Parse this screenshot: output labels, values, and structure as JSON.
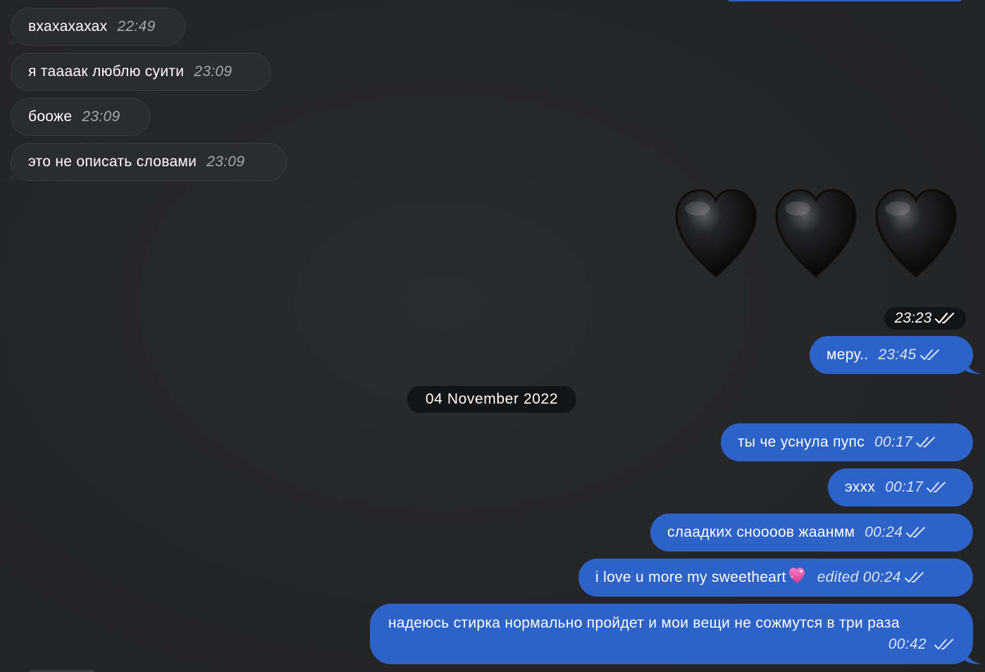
{
  "incoming": [
    {
      "text": "вхахахахах",
      "time": "22:49"
    },
    {
      "text": "я таааак люблю суити",
      "time": "23:09"
    },
    {
      "text": "бооже",
      "time": "23:09"
    },
    {
      "text": "это не описать словами",
      "time": "23:09"
    }
  ],
  "sticker": {
    "icon": "black-heart-icon",
    "count": 3,
    "time": "23:23"
  },
  "outgoing_before_date": [
    {
      "text": "меру..",
      "time": "23:45"
    }
  ],
  "date_separator": "04 November 2022",
  "outgoing": [
    {
      "text": "ты че уснула пупс",
      "time": "00:17"
    },
    {
      "text": "эххх",
      "time": "00:17"
    },
    {
      "text": "слаадких сноооов жаанмм",
      "time": "00:24"
    },
    {
      "text": "i love u more my sweetheart",
      "emoji": "sparkling-heart-icon",
      "edited_label": "edited",
      "time": "00:24"
    },
    {
      "text": "надеюсь стирка нормально пройдет и мои вещи не сожмутся в три раза",
      "time": "00:42"
    }
  ],
  "colors": {
    "background": "#242527",
    "incoming_bubble": "#2b2c2f",
    "outgoing_bubble": "#2d62c8",
    "pill": "#131416"
  }
}
